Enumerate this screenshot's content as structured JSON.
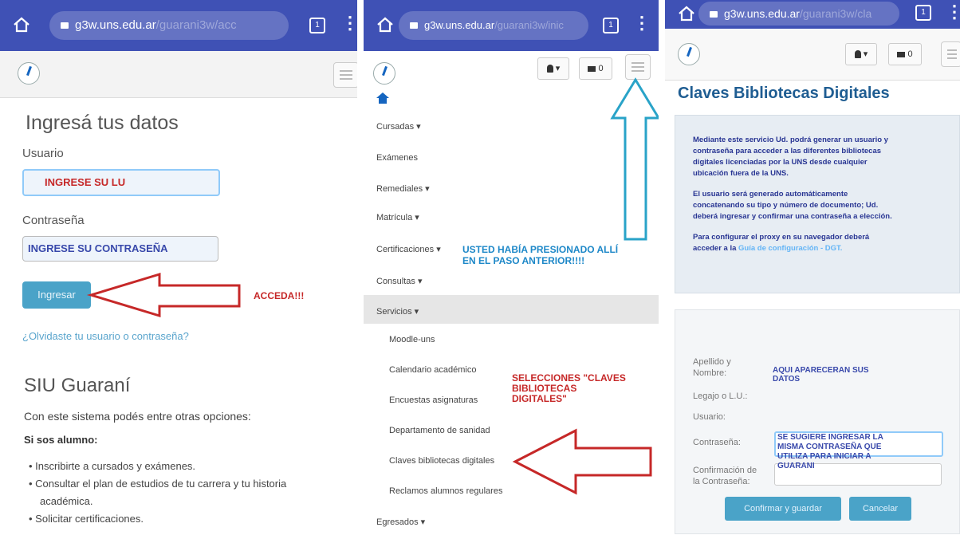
{
  "browser": {
    "url_host": "g3w.uns.edu.ar",
    "url_path_p1": "/guarani3w/acc",
    "url_path_p2": "/guarani3w/inic",
    "url_path_p3": "/guarani3w/cla",
    "tab_count": "1"
  },
  "login": {
    "title": "Ingresá tus datos",
    "user_label": "Usuario",
    "user_value": "INGRESE SU LU",
    "pass_label": "Contraseña",
    "pass_value": "INGRESE SU CONTRASEÑA",
    "submit_label": "Ingresar",
    "annotation": "ACCEDA!!!",
    "forgot_link": "¿Olvidaste tu usuario o contraseña?",
    "siu_title": "SIU Guaraní",
    "siu_intro": "Con este sistema podés entre otras opciones:",
    "siu_alumno": "Si sos alumno:",
    "bullets": [
      "Inscribirte a cursados y exámenes.",
      "Consultar el plan de estudios de tu carrera y tu historia",
      "académica.",
      "Solicitar certificaciones."
    ]
  },
  "menu": {
    "user_btn": "▾",
    "msg_btn": "0",
    "items": [
      "Cursadas ▾",
      "Exámenes",
      "Remediales ▾",
      "Matrícula ▾",
      "Certificaciones ▾",
      "Consultas ▾",
      "Servicios ▾"
    ],
    "sub_items": [
      "Moodle-uns",
      "Calendario académico",
      "Encuestas asignaturas",
      "Departamento de sanidad",
      "Claves bibliotecas digitales",
      "Reclamos alumnos regulares"
    ],
    "last_item": "Egresados ▾",
    "annotation_blue_1": "USTED HABÍA PRESIONADO ALLÍ",
    "annotation_blue_2": "EN EL PASO ANTERIOR!!!!",
    "annotation_red_1": "SELECCIONES \"CLAVES",
    "annotation_red_2": "BIBLIOTECAS",
    "annotation_red_3": "DIGITALES\""
  },
  "claves": {
    "title": "Claves Bibliotecas Digitales",
    "info_1": [
      "Mediante este servicio Ud. podrá generar un usuario y",
      "contraseña para acceder a las diferentes bibliotecas",
      "digitales licenciadas por la UNS desde cualquier",
      "ubicación fuera de la UNS."
    ],
    "info_2": [
      "El usuario será generado automáticamente",
      "concatenando su tipo y número de documento; Ud.",
      "deberá ingresar y confirmar una contraseña a elección."
    ],
    "info_3": [
      "Para configurar el proxy en su navegador deberá",
      "acceder a la "
    ],
    "info_link": "Guía de configuración - DGT.",
    "lbl_apellido_1": "Apellido y",
    "lbl_apellido_2": "Nombre:",
    "lbl_legajo": "Legajo o L.U.:",
    "lbl_usuario": "Usuario:",
    "lbl_pass": "Contraseña:",
    "lbl_conf_1": "Confirmación de",
    "lbl_conf_2": "la Contraseña:",
    "annot_datos_1": "AQUI APARECERAN SUS",
    "annot_datos_2": "DATOS",
    "annot_pass_1": "SE SUGIERE INGRESAR LA",
    "annot_pass_2": "MISMA CONTRASEÑA QUE",
    "annot_pass_3": "UTILIZA PARA INICIAR A",
    "annot_pass_4": "GUARANI",
    "btn_confirm": "Confirmar y guardar",
    "btn_cancel": "Cancelar"
  }
}
